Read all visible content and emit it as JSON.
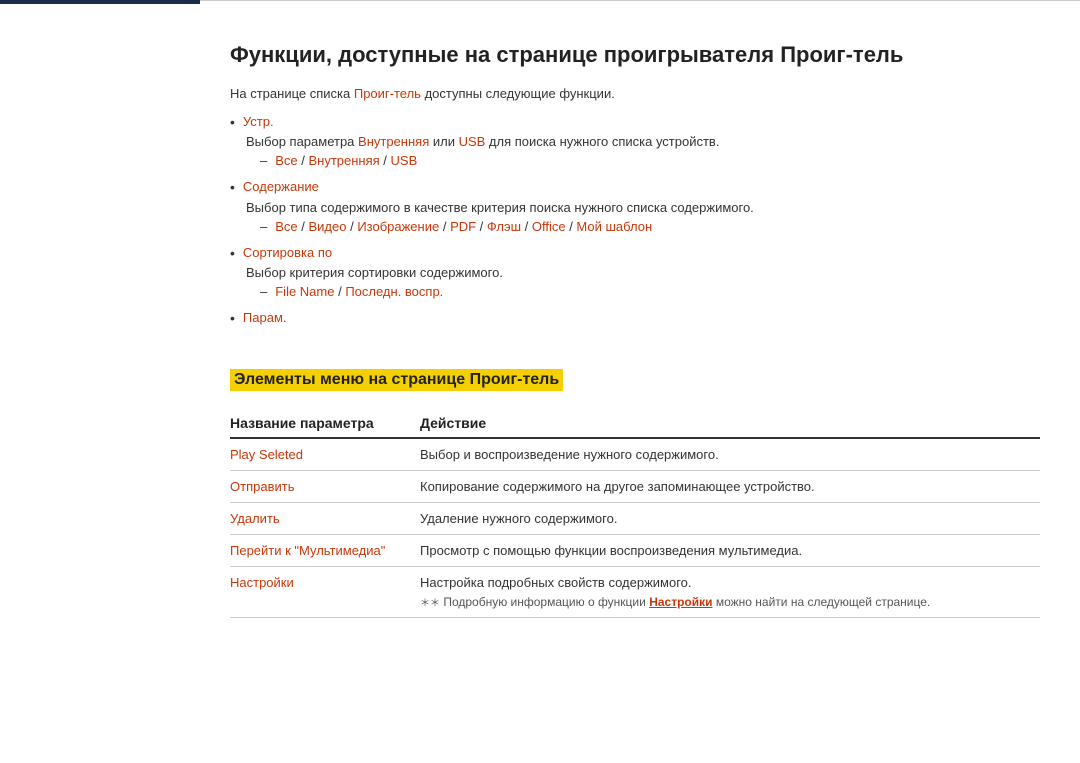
{
  "sidebar": {
    "accent_color": "#1a2a4a"
  },
  "page": {
    "title": "Функции, доступные на странице проигрывателя Проиг-тель",
    "intro": {
      "text_before": "На странице списка ",
      "link1": "Проиг-тель",
      "text_after": " доступны следующие функции."
    },
    "bullets": [
      {
        "label": "Устр.",
        "description": "Выбор параметра ",
        "link_internal": "Внутренняя",
        "text_mid": " или ",
        "link_usb": "USB",
        "text_end": " для поиска нужного списка устройств.",
        "subbullet": "Все / Внутренняя / USB",
        "subbullet_parts": [
          "Все",
          " / ",
          "Внутренняя",
          " / ",
          "USB"
        ]
      },
      {
        "label": "Содержание",
        "description": "Выбор типа содержимого в качестве критерия поиска нужного списка содержимого.",
        "subbullet": "Все / Видео / Изображение / PDF / Флэш / Office / Мой шаблон",
        "subbullet_parts": [
          "Все",
          " / ",
          "Видео",
          " / ",
          "Изображение",
          " / ",
          "PDF",
          " / ",
          "Флэш",
          " / ",
          "Office",
          " / ",
          "Мой шаблон"
        ]
      },
      {
        "label": "Сортировка по",
        "description": "Выбор критерия сортировки содержимого.",
        "subbullet": "File Name / Последн. воспр.",
        "subbullet_parts": [
          "File Name",
          " / ",
          "Последн. воспр."
        ]
      },
      {
        "label": "Парам.",
        "description": "",
        "subbullet": null
      }
    ],
    "section_heading": "Элементы меню на странице Проиг-тель",
    "table": {
      "col1_header": "Название параметра",
      "col2_header": "Действие",
      "rows": [
        {
          "name": "Play Seleted",
          "name_color": "red",
          "action": "Выбор и воспроизведение нужного содержимого.",
          "note": null
        },
        {
          "name": "Отправить",
          "name_color": "red",
          "action": "Копирование содержимого на другое запоминающее устройство.",
          "note": null
        },
        {
          "name": "Удалить",
          "name_color": "red",
          "action": "Удаление нужного содержимого.",
          "note": null
        },
        {
          "name": "Перейти к \"Мультимедиа\"",
          "name_color": "red",
          "action": "Просмотр с помощью функции воспроизведения мультимедиа.",
          "note": null
        },
        {
          "name": "Настройки",
          "name_color": "red",
          "action": "Настройка подробных свойств содержимого.",
          "note": "Подробную информацию о функции Настройки можно найти на следующей странице.",
          "note_link": "Настройки"
        }
      ]
    }
  }
}
